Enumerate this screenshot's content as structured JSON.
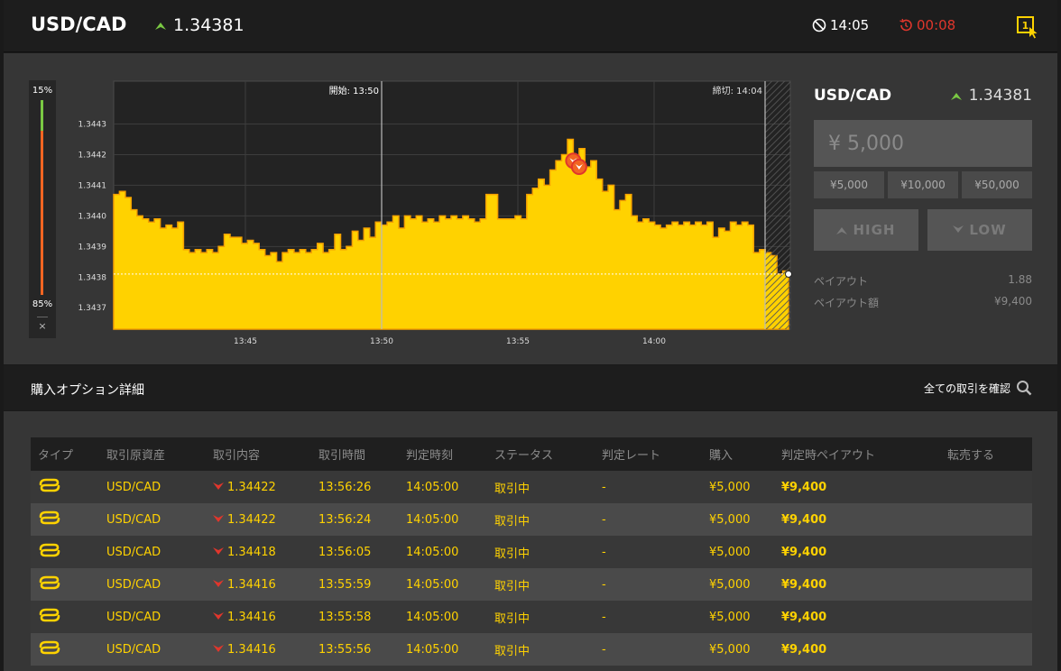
{
  "header": {
    "pair": "USD/CAD",
    "rate": "1.34381",
    "rate_direction_icon": "arrow-up-icon",
    "time": "14:05",
    "remaining": "00:08",
    "badge": "1"
  },
  "colors": {
    "accent_yellow": "#ffd200",
    "up_green": "#7ac943",
    "down_red": "#e0362c",
    "gauge_orange": "#f26522"
  },
  "gauge": {
    "top_label": "15%",
    "bottom_label": "85%",
    "close_label": "×"
  },
  "chart_data": {
    "type": "area",
    "start_label": "開始: 13:50",
    "end_label": "締切: 14:04",
    "x_ticks": [
      "13:45",
      "13:50",
      "13:55",
      "14:00"
    ],
    "y_ticks": [
      "1.3443",
      "1.3442",
      "1.3441",
      "1.3440",
      "1.3439",
      "1.3438",
      "1.3437"
    ],
    "ylim": [
      1.34363,
      1.34444
    ],
    "current_rate": 1.34381,
    "series": [
      {
        "values": [
          1.34407,
          1.34408,
          1.34406,
          1.34402,
          1.344,
          1.34399,
          1.34398,
          1.34399,
          1.34396,
          1.34397,
          1.34396,
          1.34398,
          1.34389,
          1.34388,
          1.34389,
          1.34388,
          1.34389,
          1.34388,
          1.3439,
          1.34394,
          1.34393,
          1.34393,
          1.34391,
          1.34392,
          1.34391,
          1.34389,
          1.34387,
          1.34388,
          1.34385,
          1.34388,
          1.34389,
          1.34388,
          1.34389,
          1.34388,
          1.34389,
          1.34391,
          1.34388,
          1.34389,
          1.34394,
          1.34389,
          1.3439,
          1.34395,
          1.34392,
          1.34396,
          1.34393,
          1.34398,
          1.34397,
          1.34398,
          1.344,
          1.34396,
          1.344,
          1.34399,
          1.344,
          1.34398,
          1.34399,
          1.34398,
          1.344,
          1.34399,
          1.344,
          1.34399,
          1.344,
          1.34399,
          1.34398,
          1.34399,
          1.34407,
          1.34407,
          1.34399,
          1.34399,
          1.34399,
          1.344,
          1.34399,
          1.34407,
          1.34409,
          1.34412,
          1.3441,
          1.34415,
          1.34418,
          1.3442,
          1.34425,
          1.34418,
          1.34422,
          1.34416,
          1.34418,
          1.34412,
          1.34408,
          1.3441,
          1.34402,
          1.34405,
          1.34407,
          1.344,
          1.34398,
          1.34399,
          1.34398,
          1.34397,
          1.34396,
          1.34397,
          1.34398,
          1.34397,
          1.34398,
          1.34397,
          1.34398,
          1.34397,
          1.34398,
          1.34393,
          1.34396,
          1.34395,
          1.34398,
          1.34397,
          1.34398,
          1.34397,
          1.34388,
          1.34389,
          1.34388,
          1.34387,
          1.34381,
          1.34382,
          1.34381
        ]
      }
    ],
    "markers": [
      {
        "index": 79,
        "value": 1.34418
      },
      {
        "index": 80,
        "value": 1.34416
      }
    ]
  },
  "side": {
    "pair": "USD/CAD",
    "rate": "1.34381",
    "amount_placeholder": "¥ 5,000",
    "presets": [
      "¥5,000",
      "¥10,000",
      "¥50,000"
    ],
    "high_label": "HIGH",
    "low_label": "LOW",
    "payout_label": "ペイアウト",
    "payout_value": "1.88",
    "payout_amount_label": "ペイアウト額",
    "payout_amount_value": "¥9,400"
  },
  "details": {
    "title": "購入オプション詳細",
    "all_trades_link": "全ての取引を確認"
  },
  "table": {
    "columns": [
      "タイプ",
      "取引原資産",
      "取引内容",
      "取引時間",
      "判定時刻",
      "ステータス",
      "判定レート",
      "購入",
      "判定時ペイアウト",
      "転売する"
    ],
    "rows": [
      {
        "asset": "USD/CAD",
        "rate": "1.34422",
        "time": "13:56:26",
        "expiry": "14:05:00",
        "status": "取引中",
        "judge_rate": "-",
        "purchase": "¥5,000",
        "payout": "¥9,400"
      },
      {
        "asset": "USD/CAD",
        "rate": "1.34422",
        "time": "13:56:24",
        "expiry": "14:05:00",
        "status": "取引中",
        "judge_rate": "-",
        "purchase": "¥5,000",
        "payout": "¥9,400"
      },
      {
        "asset": "USD/CAD",
        "rate": "1.34418",
        "time": "13:56:05",
        "expiry": "14:05:00",
        "status": "取引中",
        "judge_rate": "-",
        "purchase": "¥5,000",
        "payout": "¥9,400"
      },
      {
        "asset": "USD/CAD",
        "rate": "1.34416",
        "time": "13:55:59",
        "expiry": "14:05:00",
        "status": "取引中",
        "judge_rate": "-",
        "purchase": "¥5,000",
        "payout": "¥9,400"
      },
      {
        "asset": "USD/CAD",
        "rate": "1.34416",
        "time": "13:55:58",
        "expiry": "14:05:00",
        "status": "取引中",
        "judge_rate": "-",
        "purchase": "¥5,000",
        "payout": "¥9,400"
      },
      {
        "asset": "USD/CAD",
        "rate": "1.34416",
        "time": "13:55:56",
        "expiry": "14:05:00",
        "status": "取引中",
        "judge_rate": "-",
        "purchase": "¥5,000",
        "payout": "¥9,400"
      }
    ]
  }
}
